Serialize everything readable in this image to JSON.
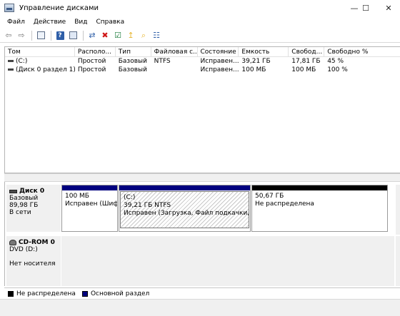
{
  "window": {
    "title": "Управление дисками",
    "controls": {
      "minimize": "—",
      "maximize": "☐",
      "close": "✕"
    }
  },
  "menu": [
    "Файл",
    "Действие",
    "Вид",
    "Справка"
  ],
  "toolbar": {
    "icons": [
      "back-arrow-icon",
      "forward-arrow-icon",
      "console-tree-icon",
      "help-icon",
      "properties-icon",
      "connect-disk-icon",
      "delete-icon",
      "check-icon",
      "folder-up-icon",
      "folder-search-icon",
      "details-view-icon"
    ],
    "glyphs": {
      "back": "⇦",
      "forward": "⇨",
      "delete": "✖",
      "check": "☑",
      "folder_up": "↥",
      "folder_search": "⌕",
      "details": "☷",
      "connect": "⇄"
    },
    "colors": {
      "arrows": "#7a7a7a",
      "help": "#2f5fa8",
      "delete": "#d01818",
      "folder": "#e7b530",
      "check": "#1a7a3a"
    }
  },
  "volume_list": {
    "columns": [
      "Том",
      "Располо...",
      "Тип",
      "Файловая с...",
      "Состояние",
      "Емкость",
      "Свобод...",
      "Свободно %"
    ],
    "rows": [
      [
        "(C:)",
        "Простой",
        "Базовый",
        "NTFS",
        "Исправен...",
        "39,21 ГБ",
        "17,81 ГБ",
        "45 %"
      ],
      [
        "(Диск 0 раздел 1)",
        "Простой",
        "Базовый",
        "",
        "Исправен...",
        "100 МБ",
        "100 МБ",
        "100 %"
      ]
    ]
  },
  "disks": [
    {
      "name": "Диск 0",
      "type": "Базовый",
      "size": "89,98 ГБ",
      "status": "В сети",
      "partitions": [
        {
          "title": "",
          "line1": "100 МБ",
          "line2": "Исправен (Шифр",
          "bar_color": "#00007f",
          "selected": false
        },
        {
          "title": "(C:)",
          "line1": "39,21 ГБ NTFS",
          "line2": "Исправен (Загрузка, Файл подкачки, Авари",
          "bar_color": "#00007f",
          "selected": true
        },
        {
          "title": "",
          "line1": "50,67 ГБ",
          "line2": "Не распределена",
          "bar_color": "#000000",
          "selected": false
        }
      ]
    },
    {
      "name": "CD-ROM 0",
      "type": "DVD (D:)",
      "size": "",
      "status": "Нет носителя"
    }
  ],
  "legend": [
    {
      "label": "Не распределена",
      "color": "#000000"
    },
    {
      "label": "Основной раздел",
      "color": "#00007f"
    }
  ]
}
